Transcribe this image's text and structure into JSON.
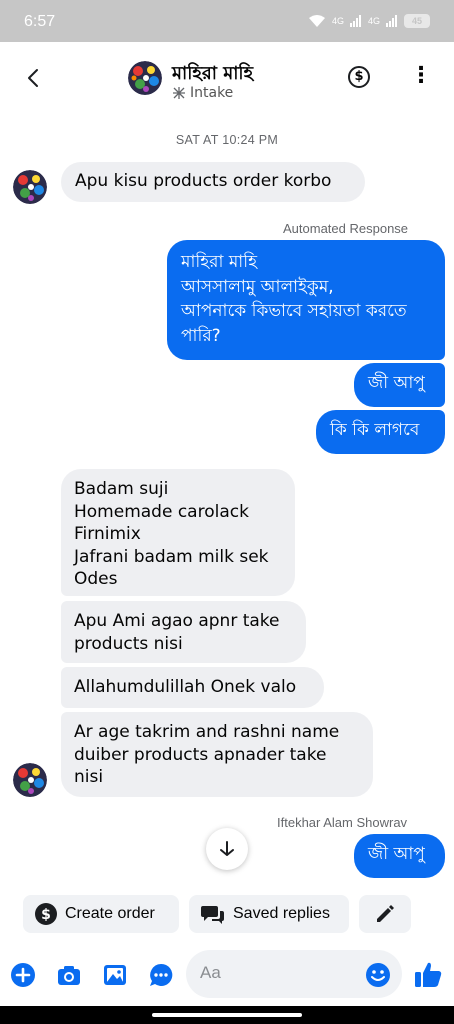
{
  "status_bar": {
    "time": "6:57",
    "net1": "4G",
    "net2": "4G",
    "battery": "45"
  },
  "header": {
    "contact_name": "মাহিরা মাহি",
    "subtitle": "Intake"
  },
  "timestamp": "SAT AT 10:24 PM",
  "messages": {
    "m1": "Apu kisu products order korbo",
    "automated_label": "Automated Response",
    "auto_line1": "মাহিরা মাহি",
    "auto_line2": "আসসালামু আলাইকুম,",
    "auto_line3": "আপনাকে কিভাবে সহায়তা করতে",
    "auto_line4": "পারি?",
    "o2": "জী আপু",
    "o3": "কি কি লাগবে",
    "list1": "Badam suji",
    "list2": "Homemade carolack",
    "list3": "Firnimix",
    "list4": "Jafrani badam milk sek",
    "list5": "Odes",
    "m3_l1": "Apu Ami agao apnr take",
    "m3_l2": "products nisi",
    "m4": "Allahumdulillah Onek valo",
    "m5_l1": "Ar age takrim and rashni  name",
    "m5_l2": "duiber products apnader take",
    "m5_l3": "nisi",
    "sender_label": "Iftekhar Alam Showrav",
    "o4": "জী আপু"
  },
  "quick_actions": {
    "create_order": "Create order",
    "saved_replies": "Saved replies"
  },
  "composer": {
    "placeholder": "Aa"
  },
  "colors": {
    "accent": "#0a6cf0",
    "incoming_bubble": "#eeeff2",
    "status_bar": "#c6c6c6"
  },
  "icons": [
    "back-icon",
    "dollar-icon",
    "more-icon",
    "intake-icon",
    "arrow-down-icon",
    "dollar-circle-icon",
    "saved-replies-icon",
    "pencil-icon",
    "plus-icon",
    "camera-icon",
    "gallery-icon",
    "chat-icon",
    "emoji-icon",
    "thumbs-up-icon"
  ]
}
